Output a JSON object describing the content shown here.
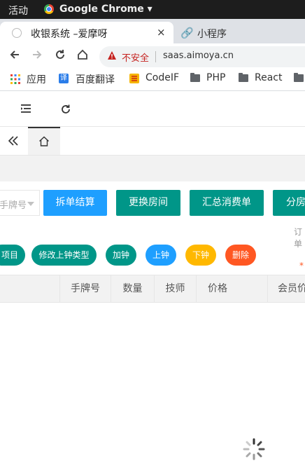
{
  "os_bar": {
    "activities": "活动",
    "app_name": "Google Chrome ▾"
  },
  "tabs": [
    {
      "title": "收银系统 –爱摩呀",
      "close": "×"
    },
    {
      "title": "小程序",
      "icon": "link-icon"
    }
  ],
  "address_bar": {
    "security_label": "不安全",
    "url": "saas.aimoya.cn"
  },
  "bookmarks": [
    {
      "label": "应用",
      "icon": "apps-grid-icon"
    },
    {
      "label": "百度翻译",
      "icon": "translate-icon"
    },
    {
      "label": "CodeIF",
      "icon": "codeif-icon"
    },
    {
      "label": "PHP",
      "icon": "folder-icon"
    },
    {
      "label": "React",
      "icon": "folder-icon"
    }
  ],
  "app": {
    "toolbar_icons": [
      "menu-fold-icon",
      "refresh-icon"
    ],
    "tag_icons": [
      "double-chevron-left-icon",
      "home-icon"
    ],
    "wristband_placeholder": "手牌号",
    "action_buttons": [
      {
        "label": "拆单结算",
        "color": "#1E9FFF"
      },
      {
        "label": "更换房间",
        "color": "#009688"
      },
      {
        "label": "汇总消费单",
        "color": "#009688"
      },
      {
        "label": "分房",
        "color": "#009688"
      }
    ],
    "order_hint": "订单",
    "required_mark": "*",
    "pill_buttons": [
      {
        "label": "项目",
        "color": "#009688"
      },
      {
        "label": "修改上钟类型",
        "color": "#009688"
      },
      {
        "label": "加钟",
        "color": "#009688"
      },
      {
        "label": "上钟",
        "color": "#1E9FFF"
      },
      {
        "label": "下钟",
        "color": "#FFB800"
      },
      {
        "label": "删除",
        "color": "#FF5722"
      }
    ],
    "table_headers": [
      "手牌号",
      "数量",
      "技师",
      "价格",
      "会员价"
    ],
    "loading_icon": "spinner-icon"
  }
}
